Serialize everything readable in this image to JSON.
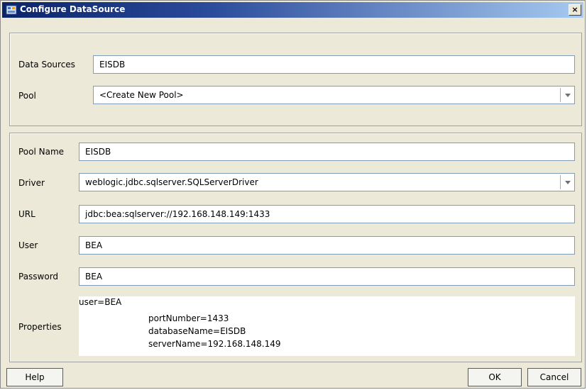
{
  "window": {
    "title": "Configure DataSource",
    "close_label": "×"
  },
  "datasource": {
    "data_sources_label": "Data Sources",
    "data_sources_value": "EISDB",
    "pool_label": "Pool",
    "pool_value": "<Create New Pool>"
  },
  "pool": {
    "pool_name_label": "Pool Name",
    "pool_name_value": "EISDB",
    "driver_label": "Driver",
    "driver_value": "weblogic.jdbc.sqlserver.SQLServerDriver",
    "url_label": "URL",
    "url_value": "jdbc:bea:sqlserver://192.168.148.149:1433",
    "user_label": "User",
    "user_value": "BEA",
    "password_label": "Password",
    "password_value": "BEA",
    "properties_label": "Properties",
    "properties_lines": [
      "user=BEA",
      "portNumber=1433",
      "databaseName=EISDB",
      "serverName=192.168.148.149"
    ]
  },
  "buttons": {
    "help": "Help",
    "ok": "OK",
    "cancel": "Cancel"
  },
  "colors": {
    "titlebar_start": "#0a246a",
    "titlebar_end": "#a6caf0",
    "dialog_bg": "#ece9d8",
    "field_border": "#7f9db9"
  },
  "icons": {
    "title": "datasource-icon",
    "combo": "chevron-down-icon"
  }
}
